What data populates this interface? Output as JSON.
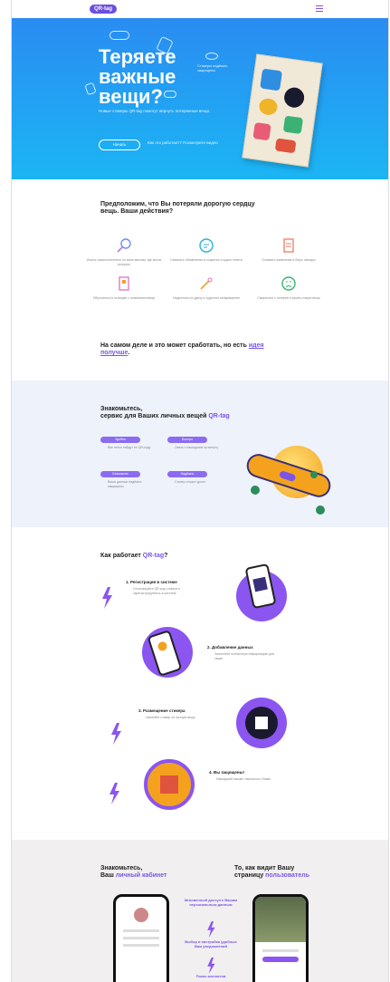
{
  "header": {
    "logo": "QR-tag"
  },
  "hero": {
    "title_lines": [
      "Теряете",
      "важные",
      "вещи?"
    ],
    "subtitle": "Новые стикеры QR-tag помогут вернуть потерянные вещи.",
    "cta": "Начать",
    "help": "Как это работает? Посмотрите видео",
    "eye_note": "Стикеры надёжно защищены"
  },
  "suppose": {
    "title": "Предположим, что Вы потеряли дорогую сердцу вещь. Ваши действия?",
    "items": [
      {
        "icon": "magnifier-icon",
        "text": "Искать самостоятельно по всем местам, где могли потерять"
      },
      {
        "icon": "chat-bubble-icon",
        "text": "Написать объявление в соцсетях и ждать ответа"
      },
      {
        "icon": "document-icon",
        "text": "Оставить заявление в бюро находок"
      },
      {
        "icon": "id-card-icon",
        "text": "Обратиться в полицию с описанием вещи"
      },
      {
        "icon": "magic-wand-icon",
        "text": "Надеяться на удачу и чудесное возвращение"
      },
      {
        "icon": "sad-face-icon",
        "text": "Смириться с потерей и купить новую вещь"
      }
    ],
    "conclusion_prefix": "На самом деле и это может сработать, но есть ",
    "conclusion_link": "идея получше",
    "conclusion_suffix": "."
  },
  "know": {
    "title_prefix": "Знакомьтесь,",
    "title_line2": "сервис для Ваших личных вещей ",
    "title_brand": "QR-tag",
    "features": [
      {
        "tag": "Удобно",
        "text": "Вас легко найдут по QR-коду"
      },
      {
        "tag": "Быстро",
        "text": "Связь с нашедшим за минуту"
      },
      {
        "tag": "Безопасно",
        "text": "Ваши данные надёжно защищены"
      },
      {
        "tag": "Надёжно",
        "text": "Стикер служит долго"
      }
    ]
  },
  "how": {
    "title_prefix": "Как работает ",
    "title_brand": "QR-tag",
    "title_suffix": "?",
    "steps": [
      {
        "n": "1.",
        "title": "Регистрация в системе",
        "text": "Отсканируйте QR-код стикера и зарегистрируйтесь в системе"
      },
      {
        "n": "2.",
        "title": "Добавление данных",
        "text": "Заполните контактную информацию для связи"
      },
      {
        "n": "3.",
        "title": "Размещение стикера",
        "text": "Наклейте стикер на личную вещь"
      },
      {
        "n": "4.",
        "title": "Вы защищены!",
        "text": "Нашедший сможет связаться с Вами"
      }
    ]
  },
  "cabinet": {
    "left_title_prefix": "Знакомьтесь,",
    "left_title_line2": "Ваш ",
    "left_title_link": "личный кабинет",
    "right_title_line1": "То, как видит Вашу",
    "right_title_line2": "страницу ",
    "right_title_link": "пользователь",
    "mid_notes": [
      "Мгновенный доступ к Вашим персональным данным",
      "Выбор и настройка удобных Вам уведомлений",
      "Показ контактов"
    ]
  },
  "colors": {
    "accent": "#7a55e8",
    "hero_top": "#2a8cf2",
    "hero_bottom": "#1bb5f3"
  }
}
